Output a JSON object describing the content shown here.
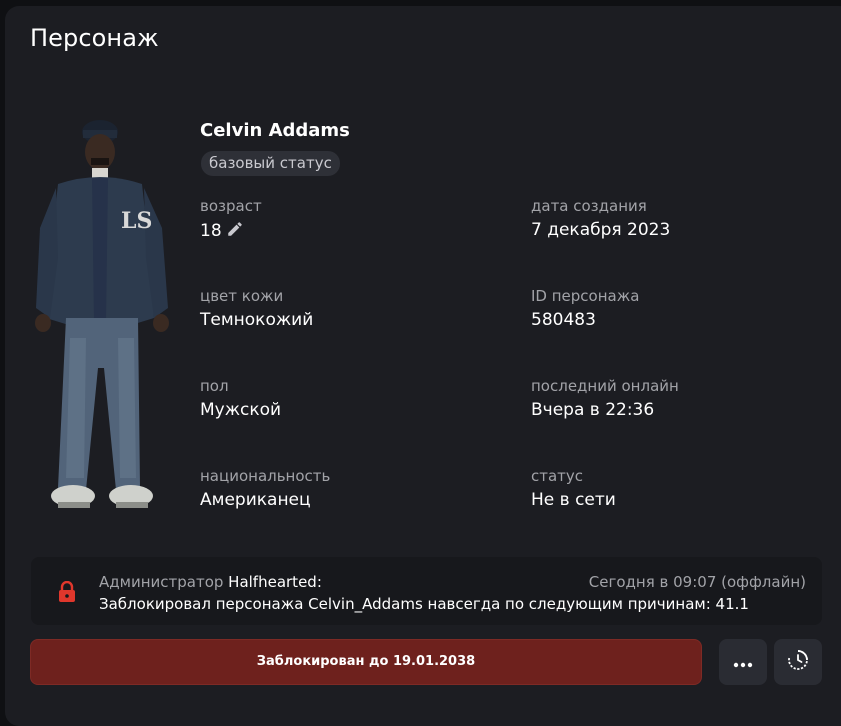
{
  "header": {
    "title": "Персонаж"
  },
  "character": {
    "name": "Celvin Addams",
    "badge": "базовый статус",
    "fields": {
      "age": {
        "label": "возраст",
        "value": "18"
      },
      "created": {
        "label": "дата создания",
        "value": "7 декабря 2023"
      },
      "skin": {
        "label": "цвет кожи",
        "value": "Темнокожий"
      },
      "id": {
        "label": "ID персонажа",
        "value": "580483"
      },
      "gender": {
        "label": "пол",
        "value": "Мужской"
      },
      "last_online": {
        "label": "последний онлайн",
        "value": "Вчера в 22:36"
      },
      "nationality": {
        "label": "национальность",
        "value": "Американец"
      },
      "status": {
        "label": "статус",
        "value": "Не в сети"
      }
    }
  },
  "notice": {
    "admin_prefix": "Администратор",
    "admin_name": "Halfhearted:",
    "time": "Сегодня в 09:07 (оффлайн)",
    "text": "Заблокировал персонажа Celvin_Addams навсегда по следующим причинам: 41.1"
  },
  "actions": {
    "ban_label": "Заблокирован до 19.01.2038",
    "more_icon": "more-dots-icon",
    "history_icon": "history-clock-icon"
  },
  "colors": {
    "panel": "#1c1d22",
    "ban_button": "#6e211d",
    "lock": "#e0372c"
  }
}
